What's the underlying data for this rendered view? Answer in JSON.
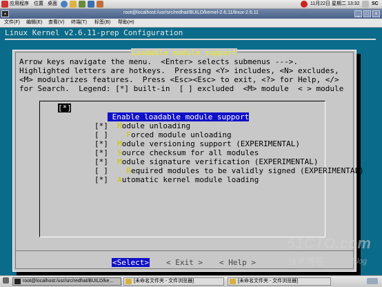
{
  "top_panel": {
    "applications": "应用程序",
    "places": "位置",
    "desktop": "桌面",
    "clock": "11月22日 星期二  13:32",
    "user": "SC"
  },
  "window": {
    "title": "root@localhost:/usr/src/redhat/BUILD/kernel-2.6.11/linux-2.6.11",
    "menu": [
      "文件(F)",
      "编辑(E)",
      "查看(V)",
      "终端(T)",
      "标签(B)",
      "帮助(H)"
    ]
  },
  "terminal": {
    "header": "Linux Kernel v2.6.11-prep Configuration",
    "dialog_title": " Loadable module support ",
    "help_lines": [
      "Arrow keys navigate the menu.  <Enter> selects submenus --->.",
      "Highlighted letters are hotkeys.  Pressing <Y> includes, <N> excludes,",
      "<M> modularizes features.  Press <Esc><Esc> to exit, <?> for Help, </>",
      "for Search.  Legend: [*] built-in  [ ] excluded  <M> module  < > module"
    ],
    "options": [
      {
        "box": "[*]",
        "pre": "",
        "hk": "E",
        "rest": "nable loadable module support",
        "selected": true
      },
      {
        "box": "[*]",
        "pre": "  ",
        "hk": "M",
        "rest": "odule unloading",
        "selected": false
      },
      {
        "box": "[ ]",
        "pre": "    ",
        "hk": "F",
        "rest": "orced module unloading",
        "selected": false
      },
      {
        "box": "[*]",
        "pre": "  ",
        "hk": "M",
        "rest": "odule versioning support (EXPERIMENTAL)",
        "selected": false
      },
      {
        "box": "[*]",
        "pre": "  ",
        "hk": "S",
        "rest": "ource checksum for all modules",
        "selected": false
      },
      {
        "box": "[*]",
        "pre": "  ",
        "hk": "M",
        "rest": "odule signature verification (EXPERIMENTAL)",
        "selected": false
      },
      {
        "box": "[ ]",
        "pre": "    ",
        "hk": "R",
        "rest": "equired modules to be validly signed (EXPERIMENTAL)",
        "selected": false
      },
      {
        "box": "[*]",
        "pre": "  ",
        "hk": "A",
        "rest": "utomatic kernel module loading",
        "selected": false
      }
    ],
    "buttons": {
      "select": "<Select>",
      "exit": "< Exit >",
      "help": "< Help >"
    }
  },
  "watermark": {
    "site": "51CTO.com",
    "cn": "技术博客",
    "blog": "Blog"
  },
  "taskbar": {
    "tasks": [
      "root@localhost:/usr/src/redhat/BUILD/ke...",
      "[未命名文件夹 - 文件浏览器]",
      "[未命名文件夹 - 文件浏览器]"
    ]
  },
  "colors": {
    "terminal_bg": "#0b6b8a",
    "dialog_bg": "#c8c8c8",
    "title_yellow": "#e8e82a",
    "highlight_blue": "#1010c8"
  }
}
